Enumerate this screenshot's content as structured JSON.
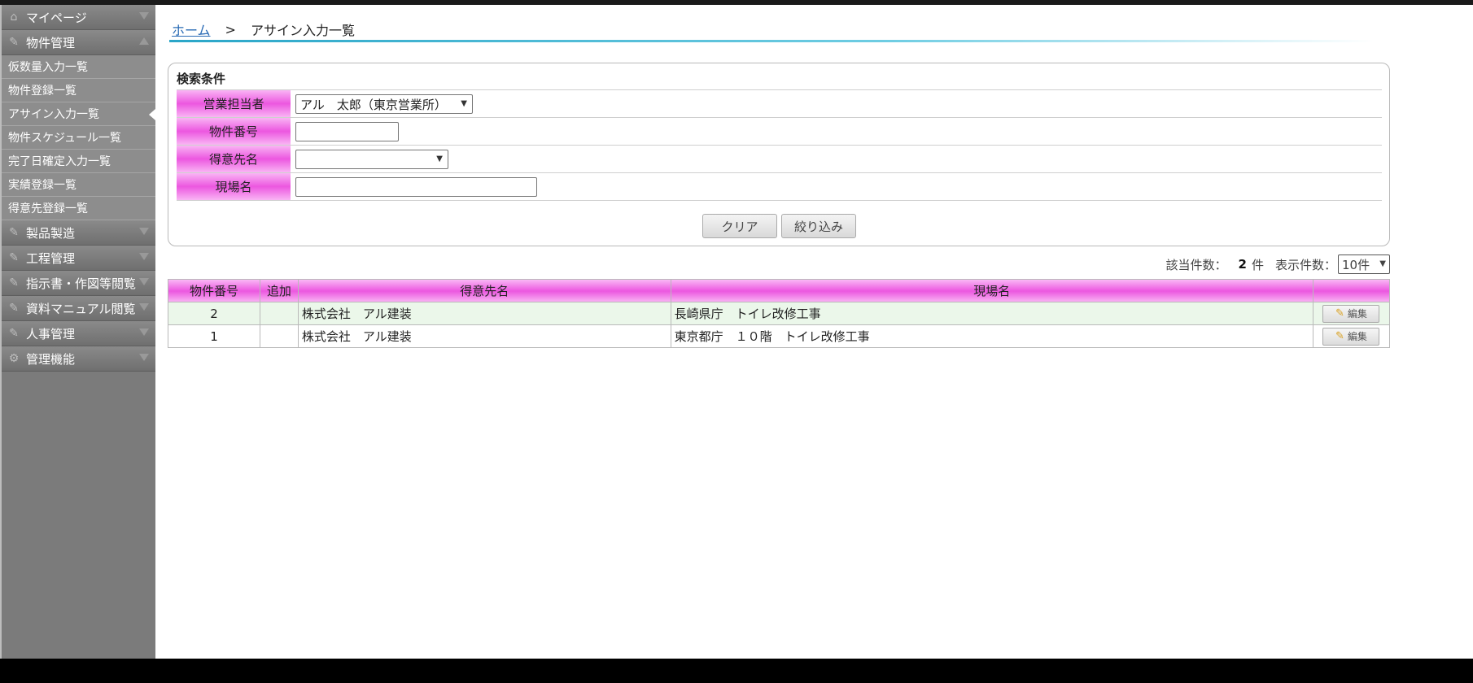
{
  "sidebar": {
    "mypage": "マイページ",
    "bukken": "物件管理",
    "sub": [
      {
        "label": "仮数量入力一覧"
      },
      {
        "label": "物件登録一覧"
      },
      {
        "label": "アサイン入力一覧"
      },
      {
        "label": "物件スケジュール一覧"
      },
      {
        "label": "完了日確定入力一覧"
      },
      {
        "label": "実績登録一覧"
      },
      {
        "label": "得意先登録一覧"
      }
    ],
    "cats": [
      {
        "label": "製品製造"
      },
      {
        "label": "工程管理"
      },
      {
        "label": "指示書・作図等閲覧"
      },
      {
        "label": "資料マニュアル閲覧"
      },
      {
        "label": "人事管理"
      },
      {
        "label": "管理機能"
      }
    ]
  },
  "breadcrumb": {
    "home": "ホーム",
    "sep": ">",
    "current": "アサイン入力一覧"
  },
  "search": {
    "title": "検索条件",
    "sales_label": "営業担当者",
    "sales_value": "アル　太郎（東京営業所）",
    "number_label": "物件番号",
    "customer_label": "得意先名",
    "site_label": "現場名",
    "clear": "クリア",
    "filter": "絞り込み"
  },
  "results": {
    "count_label": "該当件数：",
    "count": "2",
    "count_unit": "件",
    "display_label": "表示件数：",
    "display_value": "10件"
  },
  "table": {
    "headers": [
      "物件番号",
      "追加",
      "得意先名",
      "現場名",
      ""
    ],
    "rows": [
      {
        "no": "2",
        "add": "",
        "customer": "株式会社　アル建装",
        "site": "長崎県庁　トイレ改修工事",
        "edit": "編集"
      },
      {
        "no": "1",
        "add": "",
        "customer": "株式会社　アル建装",
        "site": "東京都庁　１０階　トイレ改修工事",
        "edit": "編集"
      }
    ]
  }
}
